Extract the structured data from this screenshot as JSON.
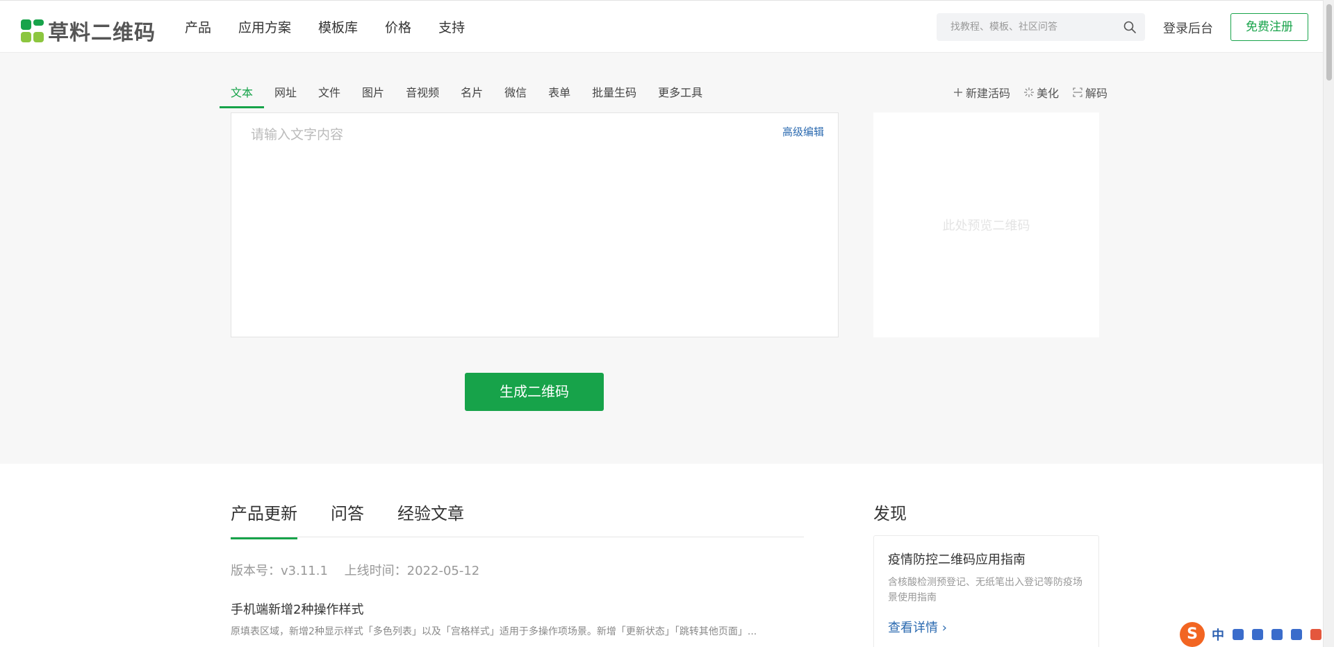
{
  "header": {
    "logo_text": "草料二维码",
    "nav": [
      "产品",
      "应用方案",
      "模板库",
      "价格",
      "支持"
    ],
    "search_placeholder": "找教程、模板、社区问答",
    "login_label": "登录后台",
    "register_label": "免费注册"
  },
  "tabs": [
    {
      "label": "文本",
      "active": true
    },
    {
      "label": "网址"
    },
    {
      "label": "文件"
    },
    {
      "label": "图片"
    },
    {
      "label": "音视频"
    },
    {
      "label": "名片"
    },
    {
      "label": "微信"
    },
    {
      "label": "表单"
    },
    {
      "label": "批量生码"
    },
    {
      "label": "更多工具"
    }
  ],
  "tools": {
    "new_live_code": "新建活码",
    "beautify": "美化",
    "decode": "解码"
  },
  "editor": {
    "placeholder": "请输入文字内容",
    "advanced_edit": "高级编辑"
  },
  "preview": {
    "text": "此处预览二维码"
  },
  "generate_button": "生成二维码",
  "lower": {
    "tabs": [
      "产品更新",
      "问答",
      "经验文章"
    ],
    "version_label": "版本号：v3.11.1",
    "release_label": "上线时间：2022-05-12",
    "update_title": "手机端新增2种操作样式",
    "update_desc": "原填表区域，新增2种显示样式「多色列表」以及「宫格样式」适用于多操作项场景。新增「更新状态」「跳转其他页面」...",
    "discover_title": "发现",
    "card": {
      "title": "疫情防控二维码应用指南",
      "desc": "含核酸检测预登记、无纸笔出入登记等防疫场景使用指南",
      "link": "查看详情 ›"
    }
  },
  "ime": {
    "zh": "中"
  },
  "colors": {
    "brand": "#17a34a",
    "link": "#2b6ab0"
  }
}
